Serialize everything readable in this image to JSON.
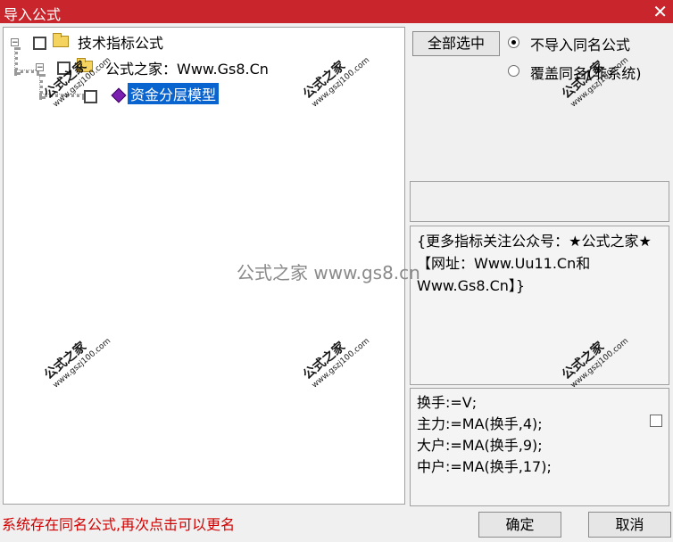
{
  "window": {
    "title": "导入公式",
    "close_glyph": "✕"
  },
  "tree": {
    "root": {
      "expander": "⊟",
      "label": "技术指标公式"
    },
    "child": {
      "expander": "⊟",
      "label": "公式之家：Www.Gs8.Cn"
    },
    "leaf": {
      "label": "资金分层模型",
      "selected": true
    }
  },
  "buttons": {
    "select_all": "全部选中",
    "ok": "确定",
    "cancel": "取消"
  },
  "options": {
    "no_import_same": {
      "label": "不导入同名公式",
      "checked": true
    },
    "overwrite_same": {
      "label": "覆盖同名(非系统)",
      "checked": false
    }
  },
  "description": "{更多指标关注公众号：★公式之家★【网址：Www.Uu11.Cn和Www.Gs8.Cn】}",
  "code_lines": [
    "换手:=V;",
    "主力:=MA(换手,4);",
    "大户:=MA(换手,9);",
    "中户:=MA(换手,17);"
  ],
  "status_message": "系统存在同名公式,再次点击可以更名",
  "watermarks": {
    "center": "公式之家 www.gs8.cn",
    "stamp_title": "公式之家",
    "stamp_url": "www.gszj100.com"
  }
}
